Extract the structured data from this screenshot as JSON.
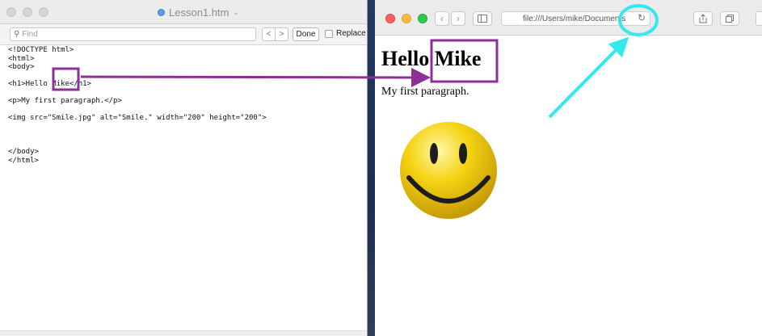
{
  "editor": {
    "title": "Lesson1.htm",
    "find": {
      "placeholder": "Find",
      "prev_label": "<",
      "next_label": ">",
      "done_label": "Done",
      "replace_label": "Replace"
    },
    "code_lines": [
      "<!DOCTYPE html>",
      "<html>",
      "<body>",
      "",
      "<h1>Hello Mike</h1>",
      "",
      "<p>My first paragraph.</p>",
      "",
      "<img src=\"Smile.jpg\" alt=\"Smile.\" width=\"200\" height=\"200\">",
      "",
      "",
      "",
      "</body>",
      "</html>"
    ]
  },
  "browser": {
    "url": "file:///Users/mike/Documents",
    "page": {
      "heading": "Hello Mike",
      "paragraph": "My first paragraph."
    }
  },
  "annotations": {
    "highlight_color": "#8e2f96",
    "pointer_color": "#35e8f0"
  },
  "colors": {
    "traffic_red": "#fc605b",
    "traffic_yellow": "#fdbc40",
    "traffic_green": "#34c84a",
    "smiley_yellow": "#f5d313"
  }
}
